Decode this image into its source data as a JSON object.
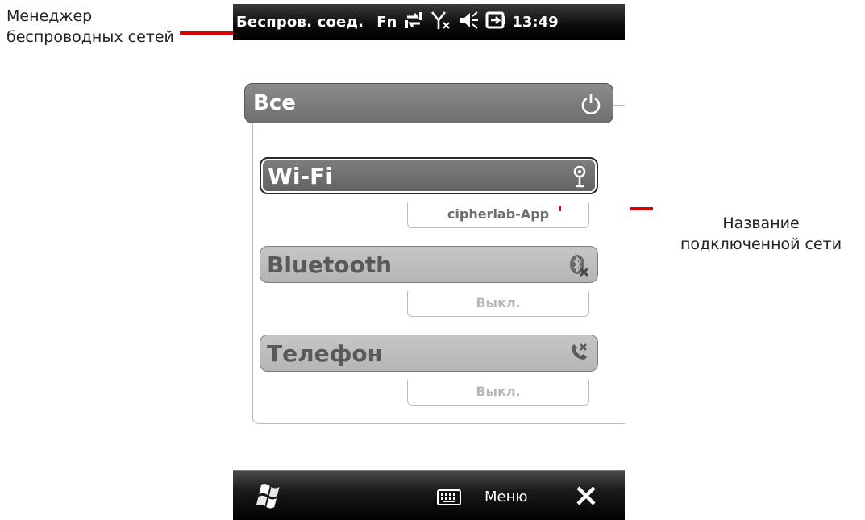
{
  "callouts": {
    "left_line1": "Менеджер",
    "left_line2": "беспроводных сетей",
    "right_line1": "Название",
    "right_line2": "подключенной сети"
  },
  "status_bar": {
    "title": "Беспров. соед.",
    "fn": "Fn",
    "time": "13:49",
    "icons": [
      "sync-arrows-icon",
      "no-signal-icon",
      "speaker-muted-icon",
      "battery-charging-icon"
    ]
  },
  "all_bar": {
    "label": "Все",
    "icon": "power-icon"
  },
  "tiles": [
    {
      "label": "Wi-Fi",
      "icon": "wifi-antenna-icon",
      "status": "cipherlab-App",
      "active": true
    },
    {
      "label": "Bluetooth",
      "icon": "bluetooth-off-icon",
      "status": "Выкл.",
      "active": false
    },
    {
      "label": "Телефон",
      "icon": "phone-off-icon",
      "status": "Выкл.",
      "active": false
    }
  ],
  "menu_bar": {
    "menu_label": "Меню",
    "icons": [
      "windows-start-icon",
      "keyboard-icon",
      "close-icon"
    ]
  },
  "colors": {
    "marker": "#e00000",
    "status_bar": "#000000",
    "active_tile": "#6f6f6f",
    "inactive_tile": "#bdbdbd"
  }
}
